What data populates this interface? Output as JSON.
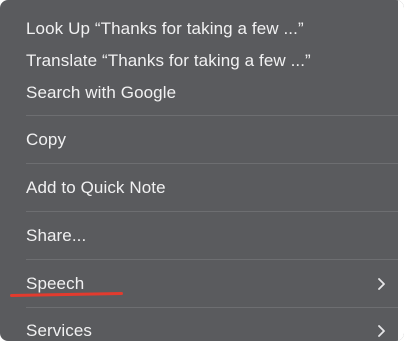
{
  "context_menu": {
    "items": [
      {
        "label": "Look Up “Thanks for taking a few ...”",
        "submenu": false
      },
      {
        "label": "Translate “Thanks for taking a few ...”",
        "submenu": false
      },
      {
        "label": "Search with Google",
        "submenu": false
      },
      {
        "label": "Copy",
        "submenu": false
      },
      {
        "label": "Add to Quick Note",
        "submenu": false
      },
      {
        "label": "Share...",
        "submenu": false
      },
      {
        "label": "Speech",
        "submenu": true
      },
      {
        "label": "Services",
        "submenu": true
      }
    ],
    "chevron_icon": "chevron-right-icon",
    "annotation_color": "#e23b2e",
    "background_color": "#5a5b5e"
  }
}
